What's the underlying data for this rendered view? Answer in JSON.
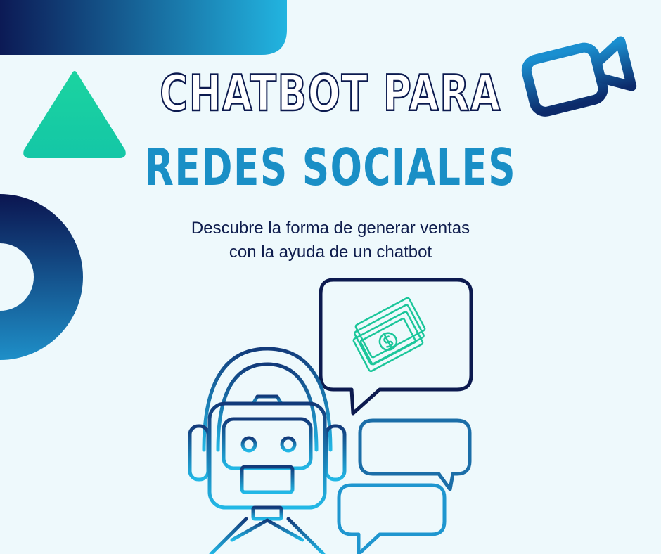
{
  "title": {
    "line1": "CHATBOT PARA",
    "line2": "REDES SOCIALES"
  },
  "subtitle": {
    "line1": "Descubre la forma de generar ventas",
    "line2": "con la ayuda de un chatbot"
  },
  "colors": {
    "background": "#eef9fc",
    "navy": "#0c1a4f",
    "blue": "#1a8fc6",
    "cyan": "#22b4e0",
    "teal": "#1bd3a0"
  },
  "icons": [
    "video-camera-icon",
    "money-bills-icon",
    "robot-headset-illustration",
    "speech-bubble-icon"
  ]
}
